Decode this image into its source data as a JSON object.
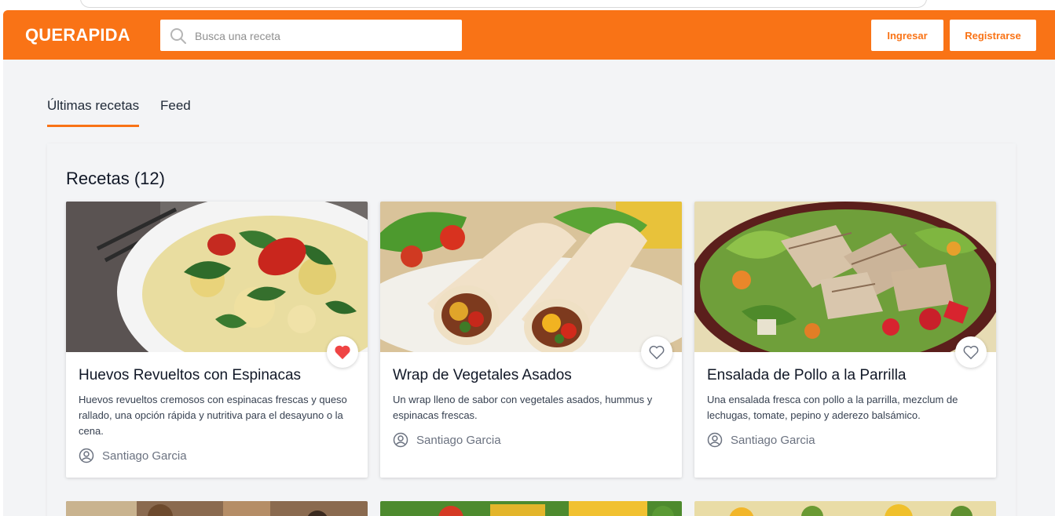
{
  "header": {
    "brand": "QUERAPIDA",
    "search_placeholder": "Busca una receta",
    "login_label": "Ingresar",
    "register_label": "Registrarse"
  },
  "tabs": [
    {
      "label": "Últimas recetas",
      "active": true
    },
    {
      "label": "Feed",
      "active": false
    }
  ],
  "recipes_heading": "Recetas (12)",
  "recipes": [
    {
      "title": "Huevos Revueltos con Espinacas",
      "description": "Huevos revueltos cremosos con espinacas frescas y queso rallado, una opción rápida y nutritiva para el desayuno o la cena.",
      "author": "Santiago Garcia",
      "favorited": true
    },
    {
      "title": "Wrap de Vegetales Asados",
      "description": "Un wrap lleno de sabor con vegetales asados, hummus y espinacas frescas.",
      "author": "Santiago Garcia",
      "favorited": false
    },
    {
      "title": "Ensalada de Pollo a la Parrilla",
      "description": "Una ensalada fresca con pollo a la parrilla, mezclum de lechugas, tomate, pepino y aderezo balsámico.",
      "author": "Santiago Garcia",
      "favorited": false
    }
  ],
  "icons": {
    "search": "search-icon",
    "favorite_filled": "heart-filled-icon",
    "favorite_empty": "heart-outline-icon",
    "author": "user-circle-icon"
  },
  "colors": {
    "accent": "#f97316",
    "favorite": "#ef4444",
    "background": "#f3f4f6"
  }
}
